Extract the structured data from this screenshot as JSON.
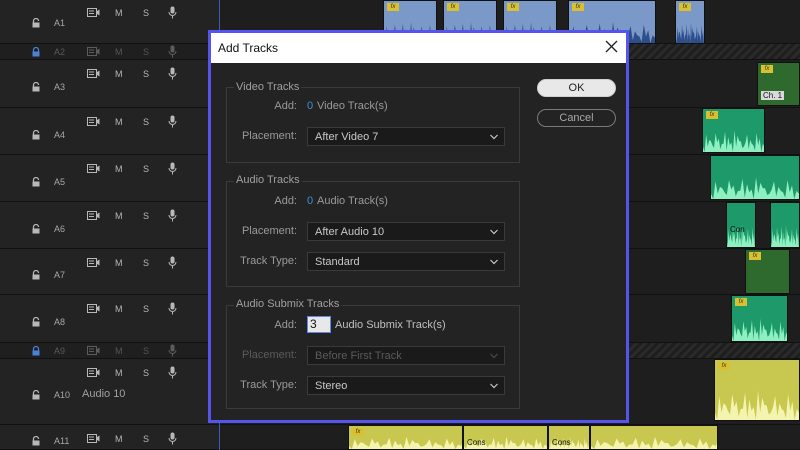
{
  "tracks": [
    {
      "name": "A1",
      "locked": false
    },
    {
      "name": "A2",
      "locked": true
    },
    {
      "name": "A3",
      "locked": false
    },
    {
      "name": "A4",
      "locked": false
    },
    {
      "name": "A5",
      "locked": false
    },
    {
      "name": "A6",
      "locked": false
    },
    {
      "name": "A7",
      "locked": false
    },
    {
      "name": "A8",
      "locked": false
    },
    {
      "name": "A9",
      "locked": true
    },
    {
      "name": "A10",
      "locked": false,
      "subtitle": "Audio 10"
    },
    {
      "name": "A11",
      "locked": false
    }
  ],
  "track_controls": {
    "mute": "M",
    "solo": "S"
  },
  "clip_labels": {
    "ch1": "Ch. 1",
    "con1": "Con",
    "cons1": "Cons",
    "cons2": "Cons"
  },
  "dialog": {
    "title": "Add Tracks",
    "video": {
      "heading": "Video Tracks",
      "add_label": "Add:",
      "count": "0",
      "unit": "Video Track(s)",
      "placement_label": "Placement:",
      "placement": "After Video 7"
    },
    "audio": {
      "heading": "Audio Tracks",
      "add_label": "Add:",
      "count": "0",
      "unit": "Audio Track(s)",
      "placement_label": "Placement:",
      "placement": "After Audio 10",
      "type_label": "Track Type:",
      "type": "Standard"
    },
    "submix": {
      "heading": "Audio Submix Tracks",
      "add_label": "Add:",
      "count": "3",
      "unit": "Audio Submix Track(s)",
      "placement_label": "Placement:",
      "placement": "Before First Track",
      "type_label": "Track Type:",
      "type": "Stereo"
    },
    "ok_label": "OK",
    "cancel_label": "Cancel"
  },
  "colors": {
    "dialog_border": "#5555ee",
    "count_value": "#3d8fd8"
  }
}
